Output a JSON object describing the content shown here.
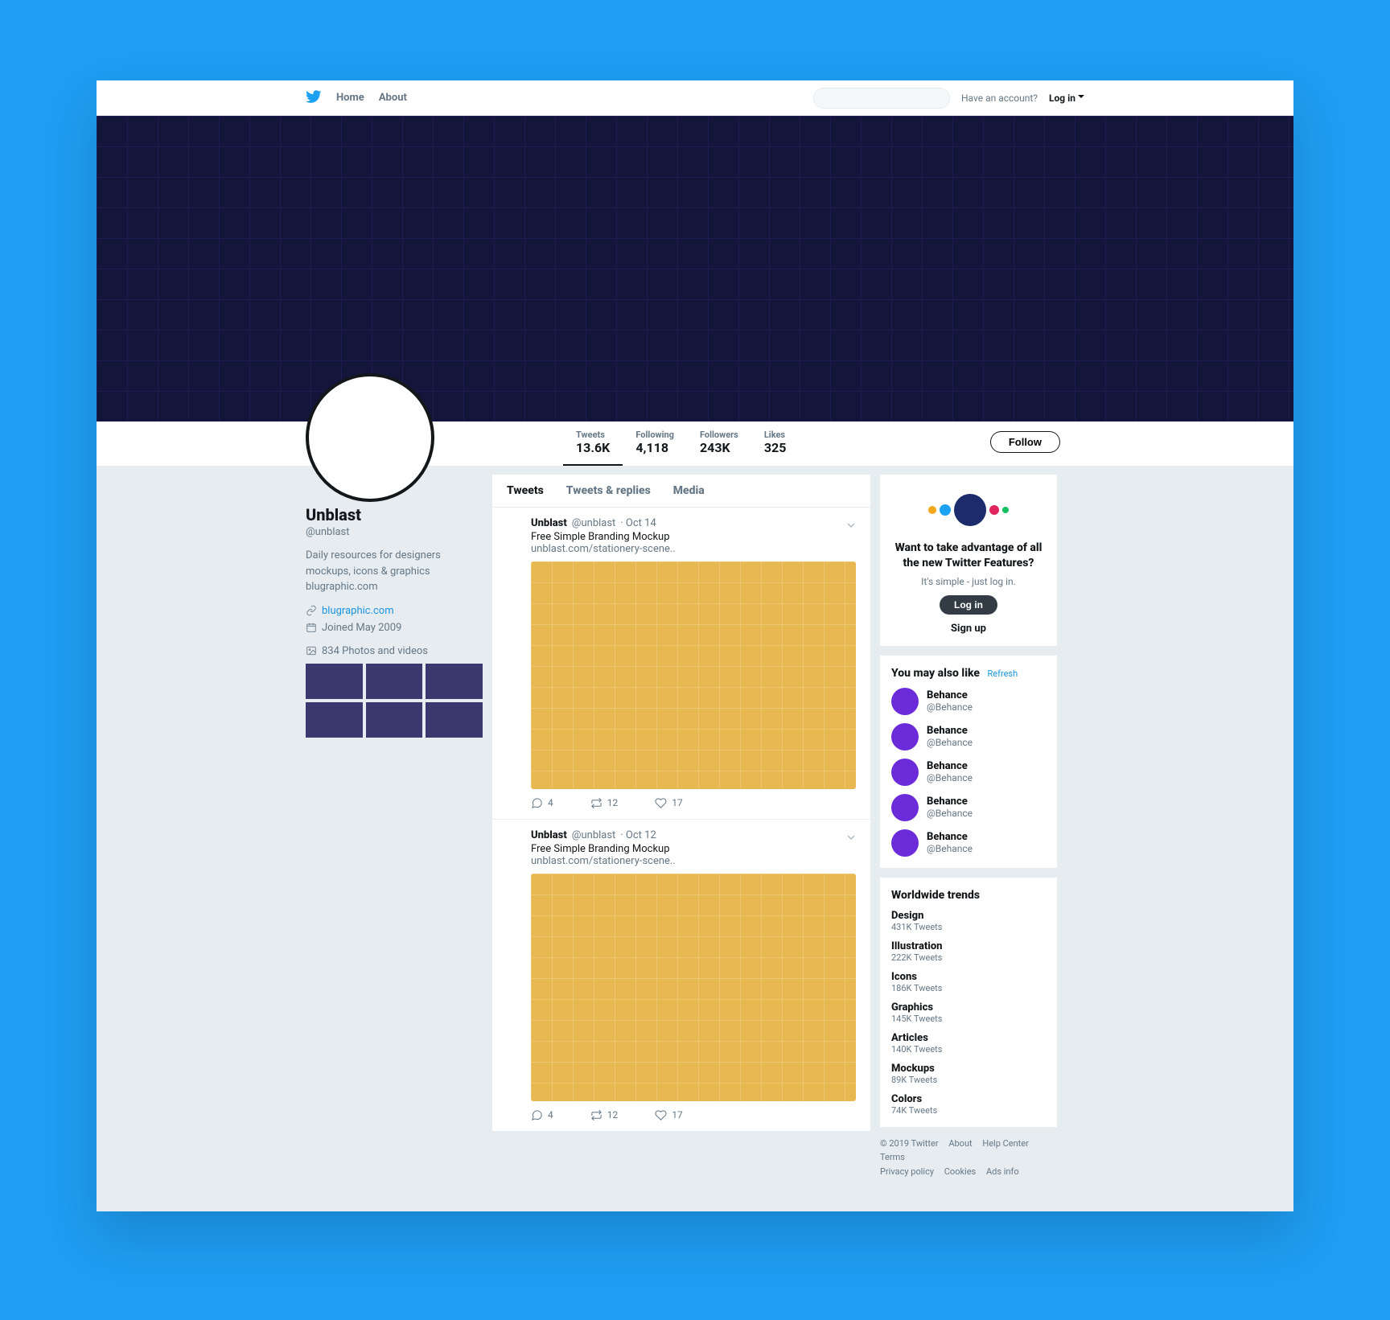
{
  "topnav": {
    "home": "Home",
    "about": "About",
    "have_account": "Have an account?",
    "login": "Log in"
  },
  "stats": {
    "tweets": {
      "label": "Tweets",
      "value": "13.6K"
    },
    "following": {
      "label": "Following",
      "value": "4,118"
    },
    "followers": {
      "label": "Followers",
      "value": "243K"
    },
    "likes": {
      "label": "Likes",
      "value": "325"
    },
    "follow_btn": "Follow"
  },
  "profile": {
    "name": "Unblast",
    "handle": "@unblast",
    "bio": "Daily resources for designers\nmockups, icons & graphics\nblugraphic.com",
    "website": "blugraphic.com",
    "joined": "Joined May 2009",
    "media_count": "834 Photos and videos"
  },
  "feed_tabs": {
    "tweets": "Tweets",
    "replies": "Tweets & replies",
    "media": "Media"
  },
  "tweets": [
    {
      "author": "Unblast",
      "handle": "@unblast",
      "date": "Oct 14",
      "text": "Free Simple Branding Mockup",
      "link": "unblast.com/stationery-scene..",
      "replies": "4",
      "retweets": "12",
      "likes": "17"
    },
    {
      "author": "Unblast",
      "handle": "@unblast",
      "date": "Oct 12",
      "text": "Free Simple Branding Mockup",
      "link": "unblast.com/stationery-scene..",
      "replies": "4",
      "retweets": "12",
      "likes": "17"
    }
  ],
  "promo": {
    "title": "Want to take advantage of all the new Twitter Features?",
    "subtitle": "It's simple - just log in.",
    "login_btn": "Log in",
    "signup": "Sign up"
  },
  "suggestions": {
    "title": "You may also like",
    "refresh": "Refresh",
    "items": [
      {
        "name": "Behance",
        "handle": "@Behance"
      },
      {
        "name": "Behance",
        "handle": "@Behance"
      },
      {
        "name": "Behance",
        "handle": "@Behance"
      },
      {
        "name": "Behance",
        "handle": "@Behance"
      },
      {
        "name": "Behance",
        "handle": "@Behance"
      }
    ]
  },
  "trends": {
    "title": "Worldwide trends",
    "items": [
      {
        "name": "Design",
        "count": "431K Tweets"
      },
      {
        "name": "Illustration",
        "count": "222K Tweets"
      },
      {
        "name": "Icons",
        "count": "186K Tweets"
      },
      {
        "name": "Graphics",
        "count": "145K Tweets"
      },
      {
        "name": "Articles",
        "count": "140K Tweets"
      },
      {
        "name": "Mockups",
        "count": "89K Tweets"
      },
      {
        "name": "Colors",
        "count": "74K Tweets"
      }
    ]
  },
  "footer": {
    "copyright": "© 2019 Twitter",
    "about": "About",
    "help": "Help Center",
    "terms": "Terms",
    "privacy": "Privacy policy",
    "cookies": "Cookies",
    "ads": "Ads info"
  },
  "colors": {
    "brand": "#1da1f2",
    "banner": "#13153b",
    "media_tile": "#3b3870",
    "tweet_media": "#e8b850",
    "suggest_avatar": "#6b2bd9"
  }
}
